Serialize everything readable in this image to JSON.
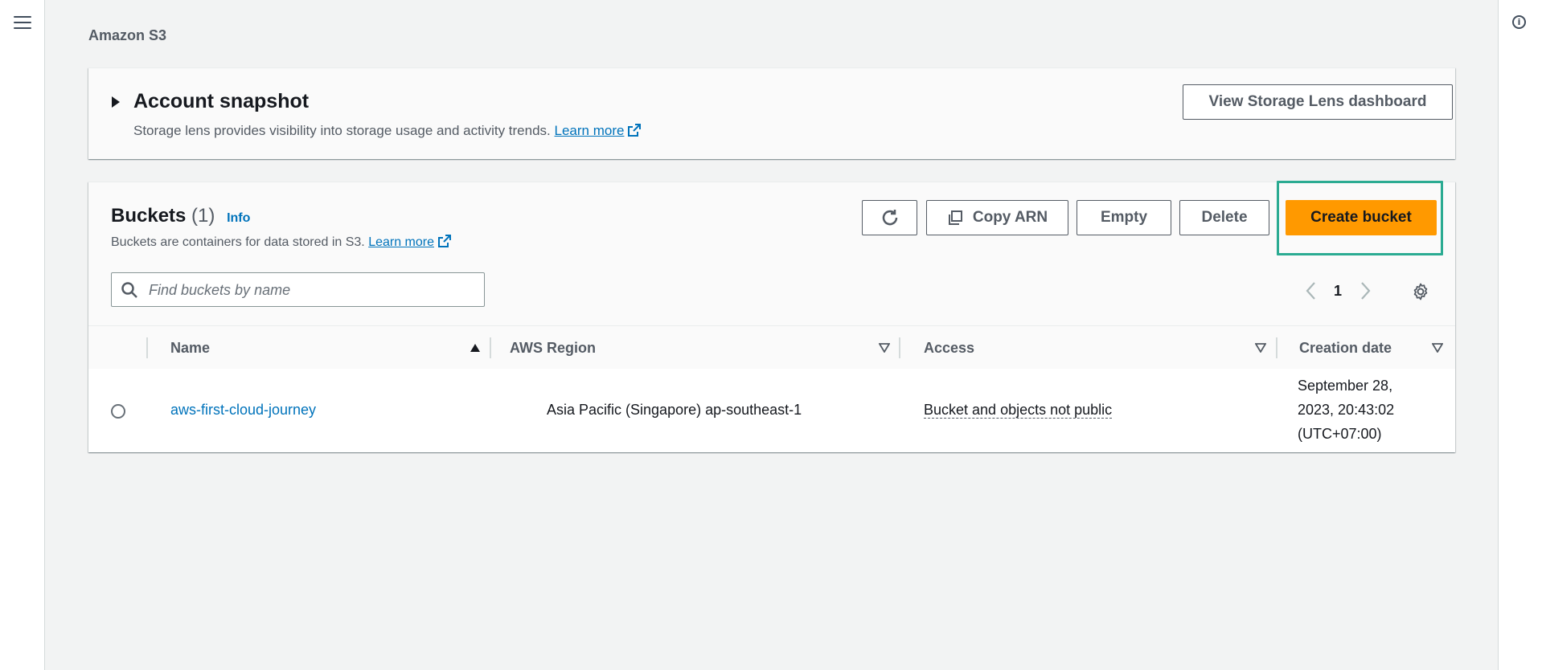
{
  "breadcrumb": "Amazon S3",
  "account_snapshot": {
    "title": "Account snapshot",
    "description": "Storage lens provides visibility into storage usage and activity trends.",
    "learn_more": "Learn more",
    "storage_lens_button": "View Storage Lens dashboard"
  },
  "buckets": {
    "title": "Buckets",
    "count": "(1)",
    "info": "Info",
    "description": "Buckets are containers for data stored in S3.",
    "learn_more": "Learn more",
    "buttons": {
      "copy_arn": "Copy ARN",
      "empty": "Empty",
      "delete": "Delete",
      "create_bucket": "Create bucket"
    },
    "search_placeholder": "Find buckets by name",
    "page_number": "1",
    "columns": [
      "Name",
      "AWS Region",
      "Access",
      "Creation date"
    ],
    "rows": [
      {
        "name": "aws-first-cloud-journey",
        "region": "Asia Pacific (Singapore) ap-southeast-1",
        "access": "Bucket and objects not public",
        "creation_date_line1": "September 28,",
        "creation_date_line2": "2023, 20:43:02",
        "creation_date_line3": "(UTC+07:00)"
      }
    ]
  },
  "icons": {
    "menu": "hamburger-menu-icon",
    "info": "info-circle-icon",
    "refresh": "refresh-icon",
    "copy": "copy-icon",
    "search": "search-icon",
    "settings": "gear-icon",
    "external": "external-link-icon"
  },
  "colors": {
    "primary_button": "#ff9900",
    "link": "#0073bb",
    "highlight": "#2bab92",
    "background": "#f2f3f3"
  }
}
